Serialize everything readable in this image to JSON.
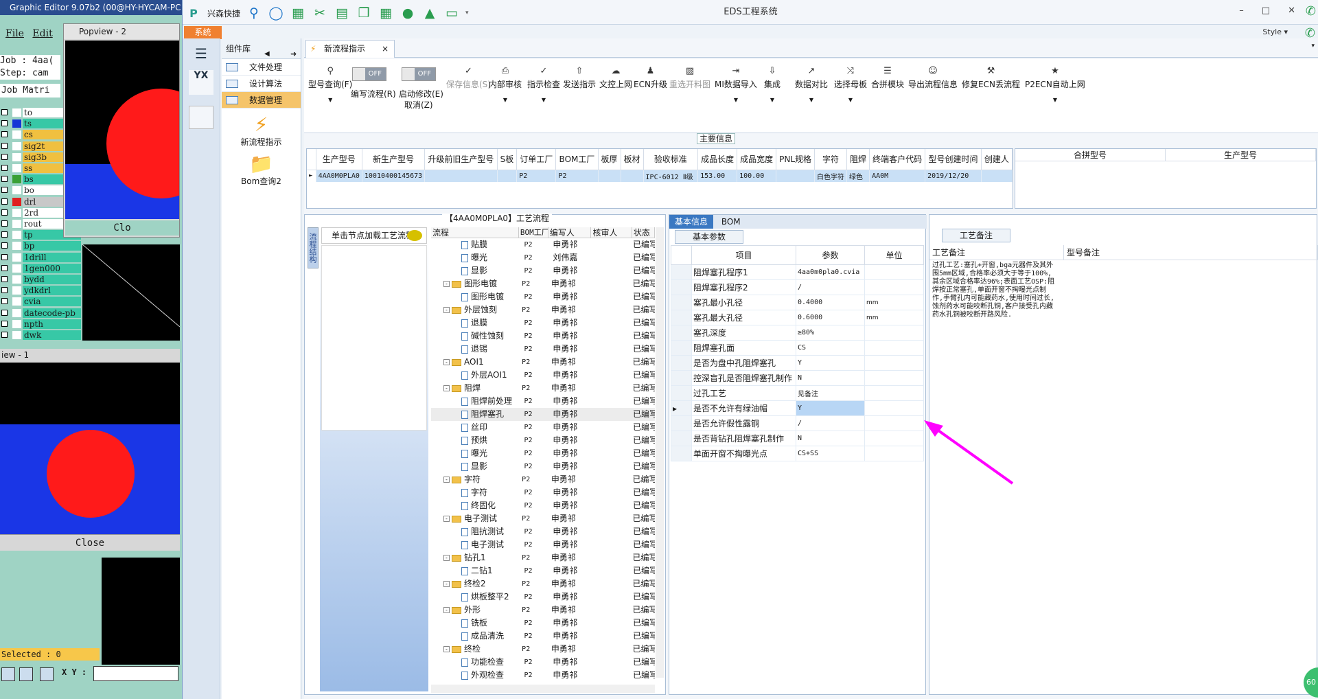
{
  "ge": {
    "title": "Graphic Editor 9.07b2 (00@HY-HYCAM-PC",
    "menu": [
      "File",
      "Edit"
    ],
    "job": "Job : 4aa(",
    "step": "Step: cam",
    "matrix": "Job Matri",
    "layers": [
      {
        "name": "to",
        "color": "#ffffff",
        "bg": "#ffffff"
      },
      {
        "name": "ts",
        "color": "#1535d6",
        "bg": "#37c8a6"
      },
      {
        "name": "cs",
        "color": "#ffffff",
        "bg": "#f0c040"
      },
      {
        "name": "sig2t",
        "color": "#ffffff",
        "bg": "#f0c040"
      },
      {
        "name": "sig3b",
        "color": "#ffffff",
        "bg": "#f0c040"
      },
      {
        "name": "ss",
        "color": "#ffffff",
        "bg": "#f0c040"
      },
      {
        "name": "bs",
        "color": "#39a035",
        "bg": "#37c8a6"
      },
      {
        "name": "bo",
        "color": "#ffffff",
        "bg": "#ffffff"
      },
      {
        "name": "drl",
        "color": "#e02020",
        "bg": "#c8c8c8"
      },
      {
        "name": "2rd",
        "color": "#ffffff",
        "bg": "#ffffff"
      },
      {
        "name": "rout",
        "color": "#ffffff",
        "bg": "#ffffff"
      },
      {
        "name": "tp",
        "color": "#ffffff",
        "bg": "#37c8a6"
      },
      {
        "name": "bp",
        "color": "#ffffff",
        "bg": "#37c8a6"
      },
      {
        "name": "1drill",
        "color": "#ffffff",
        "bg": "#37c8a6"
      },
      {
        "name": "1gen000",
        "color": "#ffffff",
        "bg": "#37c8a6"
      },
      {
        "name": "bydd",
        "color": "#ffffff",
        "bg": "#37c8a6"
      },
      {
        "name": "ydkdrl",
        "color": "#ffffff",
        "bg": "#37c8a6"
      },
      {
        "name": "cvia",
        "color": "#ffffff",
        "bg": "#37c8a6"
      },
      {
        "name": "datecode-pb",
        "color": "#ffffff",
        "bg": "#37c8a6"
      },
      {
        "name": "npth",
        "color": "#ffffff",
        "bg": "#37c8a6"
      },
      {
        "name": "dwk",
        "color": "#ffffff",
        "bg": "#37c8a6"
      }
    ],
    "popview_title": "Popview - 2",
    "popview_close": "Clo",
    "view1_title": "iew - 1",
    "view1_close": "Close",
    "selected": "Selected : 0",
    "xy_label": "X Y :"
  },
  "eds": {
    "quick_label": "兴森快捷",
    "window_title": "EDS工程系统",
    "style_label": "Style",
    "system_tab": "系统",
    "component_lib": "组件库",
    "comp_items": [
      "文件处理",
      "设计算法",
      "数据管理"
    ],
    "big_items": [
      "新流程指示",
      "Bom查询2"
    ],
    "doc_tab": "新流程指示",
    "ribbon": [
      {
        "label": "型号查询(F)",
        "icon": "search-icon",
        "dd": true
      },
      {
        "label": "保存信息(S)",
        "icon": "check-icon",
        "dd": false,
        "disabled": true
      },
      {
        "label": "内部审核",
        "icon": "print-icon",
        "dd": true
      },
      {
        "label": "指示检查",
        "icon": "check-icon",
        "dd": true
      },
      {
        "label": "发送指示",
        "icon": "upload-icon",
        "dd": false
      },
      {
        "label": "文控上网",
        "icon": "cloud-icon",
        "dd": false
      },
      {
        "label": "ECN升级",
        "icon": "users-icon",
        "dd": false
      },
      {
        "label": "重选开料图",
        "icon": "image-icon",
        "dd": false,
        "disabled": true
      },
      {
        "label": "MI数据导入",
        "icon": "import-icon",
        "dd": true
      },
      {
        "label": "集成",
        "icon": "download-icon",
        "dd": true
      },
      {
        "label": "数据对比",
        "icon": "compare-icon",
        "dd": true
      },
      {
        "label": "选择母板",
        "icon": "shuffle-icon",
        "dd": true
      },
      {
        "label": "合拼模块",
        "icon": "list-icon",
        "dd": false
      },
      {
        "label": "导出流程信息",
        "icon": "smile-icon",
        "dd": false
      },
      {
        "label": "修复ECN丢流程",
        "icon": "wrench-icon",
        "dd": false
      },
      {
        "label": "P2ECN自动上网",
        "icon": "star-icon",
        "dd": true
      }
    ],
    "toggle_off": "OFF",
    "write_flow": "编写流程(R)",
    "auto_modify": "启动修改(E)",
    "cancel": "取消(Z)",
    "main_info": "主要信息",
    "grid1_headers": [
      "生产型号",
      "新生产型号",
      "升级前旧生产型号",
      "S板",
      "订单工厂",
      "BOM工厂",
      "板厚",
      "板材",
      "验收标准",
      "成品长度",
      "成品宽度",
      "PNL规格",
      "字符",
      "阻焊",
      "终端客户代码",
      "型号创建时间",
      "创建人"
    ],
    "grid1_row": [
      "4AA0M0PLA0",
      "10010400145673",
      "",
      "",
      "P2",
      "P2",
      "",
      "",
      "IPC-6012 Ⅱ级",
      "153.00",
      "100.00",
      "",
      "白色字符",
      "绿色",
      "AA0M",
      "2019/12/20",
      ""
    ],
    "grid2_headers": [
      "合拼型号",
      "生产型号"
    ],
    "flow_title": "【4AA0M0PLA0】工艺流程",
    "flow_vtab": "流程结构",
    "flow_hint": "单击节点加载工艺流程",
    "tree_headers": [
      "流程",
      "BOM工厂",
      "编写人",
      "核审人",
      "状态"
    ],
    "tree": [
      {
        "lvl": 2,
        "name": "贴膜",
        "f": "P2",
        "w": "申勇祁",
        "s": "已编写"
      },
      {
        "lvl": 2,
        "name": "曝光",
        "f": "P2",
        "w": "刘伟嘉",
        "s": "已编写"
      },
      {
        "lvl": 2,
        "name": "显影",
        "f": "P2",
        "w": "申勇祁",
        "s": "已编写"
      },
      {
        "lvl": 1,
        "name": "图形电镀",
        "f": "P2",
        "w": "申勇祁",
        "s": "已编写"
      },
      {
        "lvl": 2,
        "name": "图形电镀",
        "f": "P2",
        "w": "申勇祁",
        "s": "已编写"
      },
      {
        "lvl": 1,
        "name": "外层蚀刻",
        "f": "P2",
        "w": "申勇祁",
        "s": "已编写"
      },
      {
        "lvl": 2,
        "name": "退膜",
        "f": "P2",
        "w": "申勇祁",
        "s": "已编写"
      },
      {
        "lvl": 2,
        "name": "碱性蚀刻",
        "f": "P2",
        "w": "申勇祁",
        "s": "已编写"
      },
      {
        "lvl": 2,
        "name": "退锡",
        "f": "P2",
        "w": "申勇祁",
        "s": "已编写"
      },
      {
        "lvl": 1,
        "name": "AOI1",
        "f": "P2",
        "w": "申勇祁",
        "s": "已编写"
      },
      {
        "lvl": 2,
        "name": "外层AOI1",
        "f": "P2",
        "w": "申勇祁",
        "s": "已编写"
      },
      {
        "lvl": 1,
        "name": "阻焊",
        "f": "P2",
        "w": "申勇祁",
        "s": "已编写"
      },
      {
        "lvl": 2,
        "name": "阻焊前处理",
        "f": "P2",
        "w": "申勇祁",
        "s": "已编写"
      },
      {
        "lvl": 2,
        "name": "阻焊塞孔",
        "f": "P2",
        "w": "申勇祁",
        "s": "已编写",
        "sel": true
      },
      {
        "lvl": 2,
        "name": "丝印",
        "f": "P2",
        "w": "申勇祁",
        "s": "已编写"
      },
      {
        "lvl": 2,
        "name": "预烘",
        "f": "P2",
        "w": "申勇祁",
        "s": "已编写"
      },
      {
        "lvl": 2,
        "name": "曝光",
        "f": "P2",
        "w": "申勇祁",
        "s": "已编写"
      },
      {
        "lvl": 2,
        "name": "显影",
        "f": "P2",
        "w": "申勇祁",
        "s": "已编写"
      },
      {
        "lvl": 1,
        "name": "字符",
        "f": "P2",
        "w": "申勇祁",
        "s": "已编写"
      },
      {
        "lvl": 2,
        "name": "字符",
        "f": "P2",
        "w": "申勇祁",
        "s": "已编写"
      },
      {
        "lvl": 2,
        "name": "终固化",
        "f": "P2",
        "w": "申勇祁",
        "s": "已编写"
      },
      {
        "lvl": 1,
        "name": "电子测试",
        "f": "P2",
        "w": "申勇祁",
        "s": "已编写"
      },
      {
        "lvl": 2,
        "name": "阻抗测试",
        "f": "P2",
        "w": "申勇祁",
        "s": "已编写"
      },
      {
        "lvl": 2,
        "name": "电子测试",
        "f": "P2",
        "w": "申勇祁",
        "s": "已编写"
      },
      {
        "lvl": 1,
        "name": "钻孔1",
        "f": "P2",
        "w": "申勇祁",
        "s": "已编写"
      },
      {
        "lvl": 2,
        "name": "二钻1",
        "f": "P2",
        "w": "申勇祁",
        "s": "已编写"
      },
      {
        "lvl": 1,
        "name": "终检2",
        "f": "P2",
        "w": "申勇祁",
        "s": "已编写"
      },
      {
        "lvl": 2,
        "name": "烘板整平2",
        "f": "P2",
        "w": "申勇祁",
        "s": "已编写"
      },
      {
        "lvl": 1,
        "name": "外形",
        "f": "P2",
        "w": "申勇祁",
        "s": "已编写"
      },
      {
        "lvl": 2,
        "name": "铣板",
        "f": "P2",
        "w": "申勇祁",
        "s": "已编写"
      },
      {
        "lvl": 2,
        "name": "成品清洗",
        "f": "P2",
        "w": "申勇祁",
        "s": "已编写"
      },
      {
        "lvl": 1,
        "name": "终检",
        "f": "P2",
        "w": "申勇祁",
        "s": "已编写"
      },
      {
        "lvl": 2,
        "name": "功能检查",
        "f": "P2",
        "w": "申勇祁",
        "s": "已编写"
      },
      {
        "lvl": 2,
        "name": "外观检查",
        "f": "P2",
        "w": "申勇祁",
        "s": "已编写"
      }
    ],
    "basic_tabs": [
      "基本信息",
      "BOM"
    ],
    "basic_subtab": "基本参数",
    "param_headers": [
      "项目",
      "参数",
      "单位"
    ],
    "params": [
      {
        "k": "阻焊塞孔程序1",
        "v": "4aa0m0pla0.cvia",
        "u": ""
      },
      {
        "k": "阻焊塞孔程序2",
        "v": "/",
        "u": ""
      },
      {
        "k": "塞孔最小孔径",
        "v": "0.4000",
        "u": "mm"
      },
      {
        "k": "塞孔最大孔径",
        "v": "0.6000",
        "u": "mm"
      },
      {
        "k": "塞孔深度",
        "v": "≥80%",
        "u": ""
      },
      {
        "k": "阻焊塞孔面",
        "v": "CS",
        "u": ""
      },
      {
        "k": "是否为盘中孔阻焊塞孔",
        "v": "Y",
        "u": ""
      },
      {
        "k": "控深盲孔是否阻焊塞孔制作",
        "v": "N",
        "u": ""
      },
      {
        "k": "过孔工艺",
        "v": "见备注",
        "u": ""
      },
      {
        "k": "是否不允许有绿油帽",
        "v": "Y",
        "u": "",
        "hl": true
      },
      {
        "k": "是否允许假性露铜",
        "v": "/",
        "u": ""
      },
      {
        "k": "是否背钻孔阻焊塞孔制作",
        "v": "N",
        "u": ""
      },
      {
        "k": "单面开窗不掏曝光点",
        "v": "CS+SS",
        "u": ""
      }
    ],
    "notes_tab": "工艺备注",
    "notes_headers": [
      "工艺备注",
      "型号备注"
    ],
    "notes_text": "过孔工艺:塞孔+开窗,bga元器件及其外围5mm区域,合格率必须大于等于100%,其余区域合格率达96%;表面工艺OSP:阻焊按正常塞孔,单面开窗不掏曝光点制作,手臂孔内可能藏药水,使用时间过长,蚀剂药水可能咬断孔铜,客户接受孔内藏药水孔铜被咬断开路风险.",
    "green_badge": "60"
  }
}
